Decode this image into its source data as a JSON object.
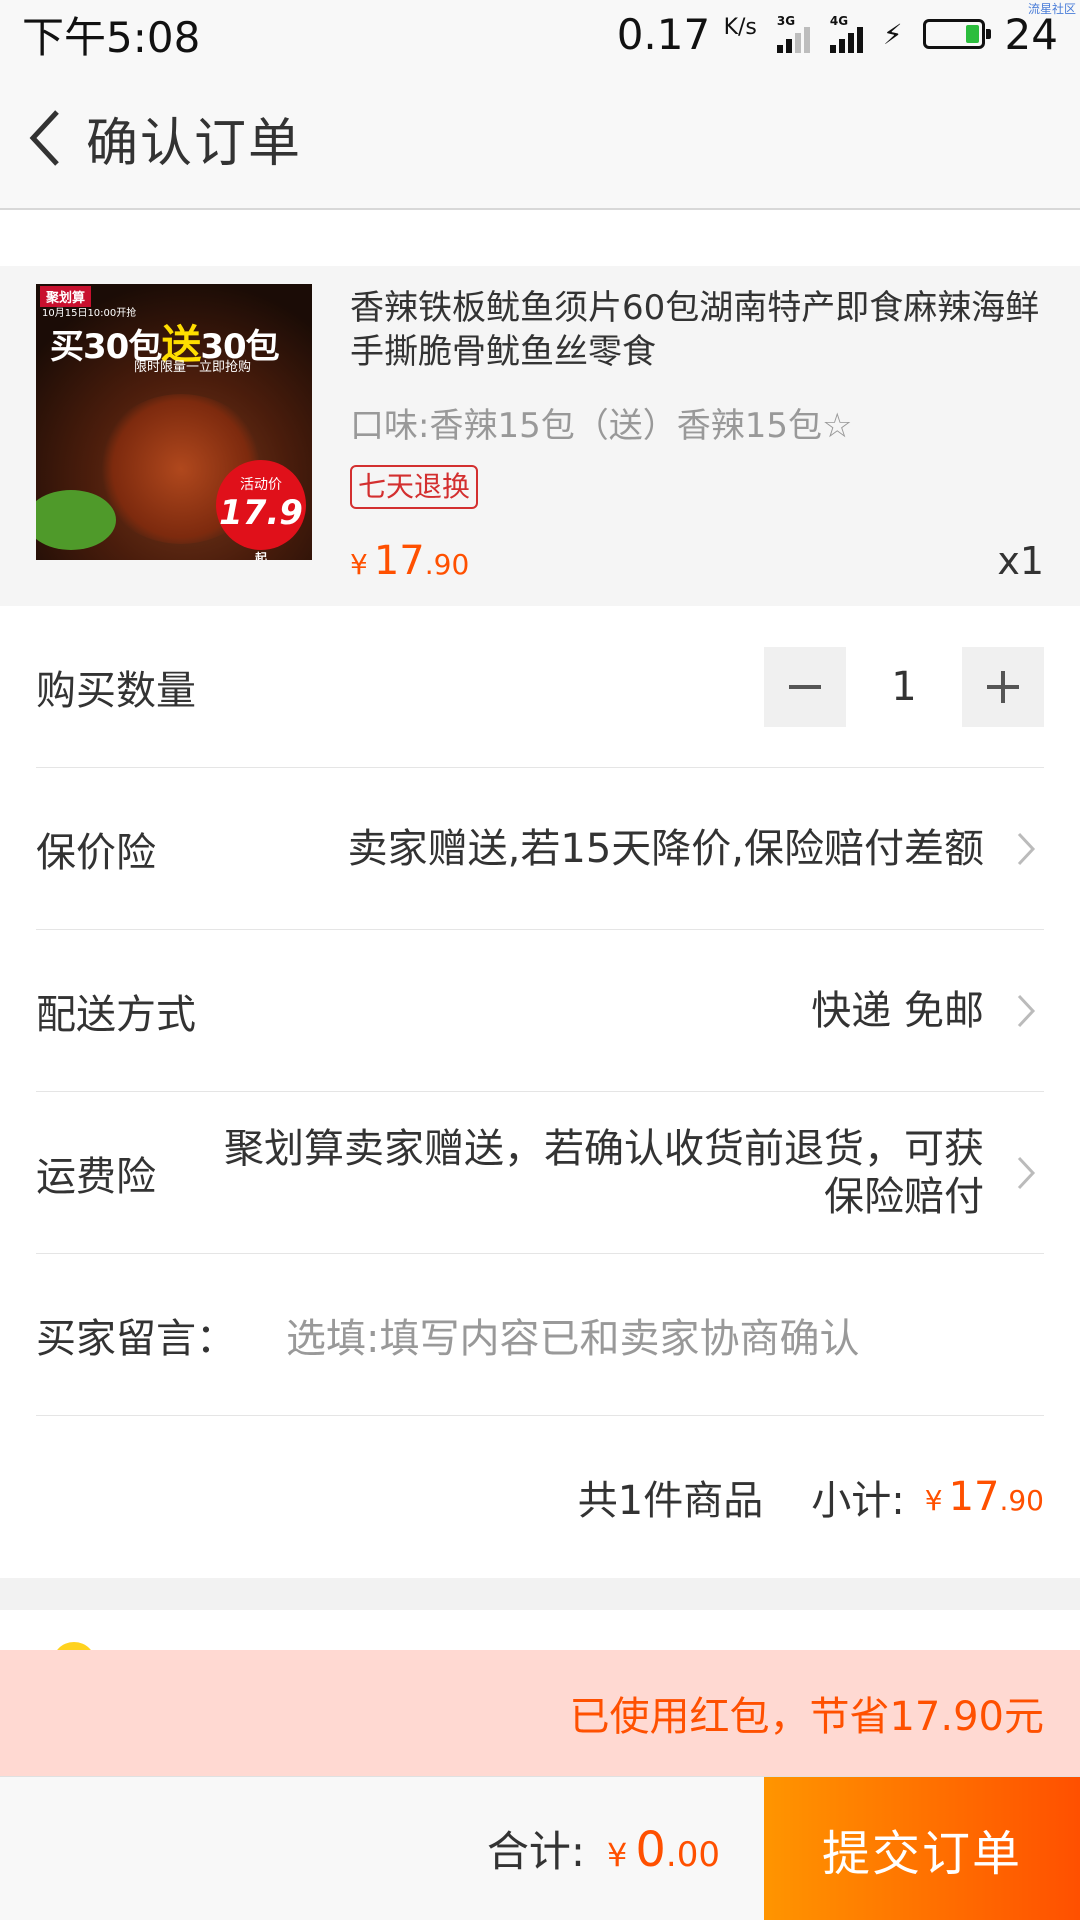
{
  "status_bar": {
    "time": "下午5:08",
    "net_speed": "0.17",
    "net_unit": "K/s",
    "sim1": "3G",
    "sim2": "4G",
    "battery_level": "24",
    "battery_fraction": 0.24,
    "watermark": "流星社区"
  },
  "header": {
    "title": "确认订单"
  },
  "product": {
    "thumb": {
      "tag": "聚划算",
      "date": "10月15日10:00开抢",
      "headline_a": "买30包",
      "headline_b": "送",
      "headline_c": "30包",
      "sub": "限时限量一立即抢购",
      "badge_label": "活动价",
      "badge_price": "17.9",
      "badge_suffix": "起"
    },
    "title": "香辣铁板鱿鱼须片60包湖南特产即食麻辣海鲜手撕脆骨鱿鱼丝零食",
    "spec": "口味:香辣15包（送）香辣15包☆",
    "return_tag": "七天退换",
    "price_currency": "¥",
    "price_int": "17",
    "price_dec": ".90",
    "qty": "x1"
  },
  "rows": {
    "quantity": {
      "label": "购买数量",
      "value": "1"
    },
    "price_protect": {
      "label": "保价险",
      "value": "卖家赠送,若15天降价,保险赔付差额"
    },
    "delivery": {
      "label": "配送方式",
      "value": "快递 免邮"
    },
    "shipping_ins": {
      "label": "运费险",
      "value": "聚划算卖家赠送，若确认收货前退货，可获保险赔付"
    },
    "message": {
      "label": "买家留言：",
      "placeholder": "选填:填写内容已和卖家协商确认"
    }
  },
  "subtotal": {
    "count": "共1件商品",
    "label": "小计:",
    "currency": "¥",
    "int": "17",
    "dec": ".90"
  },
  "redpack": {
    "text": "已使用红包，节省17.90元"
  },
  "footer": {
    "total_label": "合计:",
    "currency": "¥",
    "int": "0",
    "dec": ".00",
    "submit": "提交订单"
  },
  "colors": {
    "accent": "#ff5000",
    "button_start": "#ff9500",
    "redpack_bg": "#ffd9d2"
  }
}
